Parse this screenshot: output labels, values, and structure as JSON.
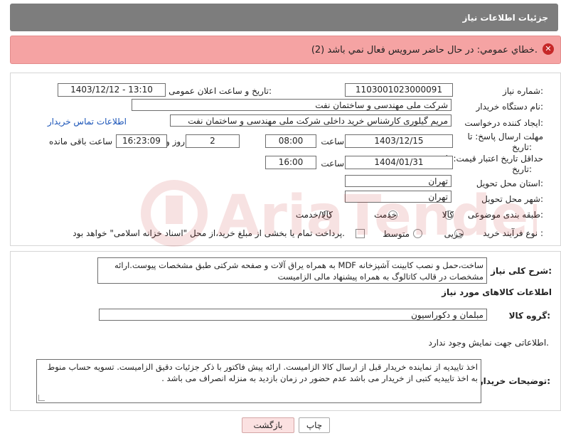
{
  "header": {
    "title": "جزئیات اطلاعات نیاز"
  },
  "error": {
    "message": "خطاي عمومي: در حال حاضر سرويس فعال نمي باشد (2)."
  },
  "form": {
    "need_number_label": "شماره نیاز:",
    "need_number": "1103001023000091",
    "announce_label": "تاریخ و ساعت اعلان عمومی:",
    "announce_value": "1403/12/12 - 13:10",
    "buyer_label": "نام دستگاه خریدار:",
    "buyer_value": "شرکت ملی مهندسی و ساختمان نفت",
    "creator_label": "ایجاد کننده درخواست:",
    "creator_value": "مریم گیلوری کارشناس خرید داخلی شرکت ملی مهندسی و ساختمان نفت",
    "contact_link": "اطلاعات تماس خریدار",
    "deadline_label_1": "مهلت ارسال پاسخ: تا",
    "deadline_label_2": "تاریخ:",
    "deadline_date": "1403/12/15",
    "time_label": "ساعت",
    "deadline_time": "08:00",
    "days_value": "2",
    "days_label": "روز و",
    "remaining_time": "16:23:09",
    "remaining_label": "ساعت باقی مانده",
    "validity_label_1": "حداقل تاریخ اعتبار قیمت: تا",
    "validity_label_2": "تاریخ:",
    "validity_date": "1404/01/31",
    "validity_time": "16:00",
    "province_label": "استان محل تحویل:",
    "province_value": "تهران",
    "city_label": "شهر محل تحویل:",
    "city_value": "تهران",
    "category_label": "طبقه بندی موضوعی:",
    "category_options": [
      "کالا",
      "خدمت",
      "کالا/خدمت"
    ],
    "process_label": "نوع فرآیند خرید :",
    "process_options": [
      "جزیی",
      "متوسط"
    ],
    "payment_note": "پرداخت تمام یا بخشی از مبلغ خرید،از محل \"اسناد خزانه اسلامی\" خواهد بود."
  },
  "details": {
    "summary_label": "شرح کلی نیاز:",
    "summary_text": "ساخت،حمل و نصب کابینت آشپزخانه MDF به همراه یراق آلات و صفحه شرکتی طبق مشخصات پیوست.ارائه مشخصات در قالب کاتالوگ به همراه پیشنهاد مالی الزامیست",
    "goods_heading": "اطلاعات کالاهای مورد نیاز",
    "group_label": "گروه کالا:",
    "group_value": "مبلمان و دکوراسیون",
    "no_info": "اطلاعاتی جهت نمایش وجود ندارد.",
    "buyer_notes_label": "توضیحات خریدار:",
    "buyer_notes_text": "اخذ تاییدیه از نماینده خریدار قبل از ارسال کالا الزامیست. ارائه پیش فاکتور با ذکر جزئیات دقیق الزامیست. تسویه حساب منوط به اخذ تاییدیه کتبی از خریدار می باشد عدم حضور در زمان بازدید به منزله انصراف می باشد ."
  },
  "buttons": {
    "print": "چاپ",
    "back": "بازگشت"
  },
  "watermark": {
    "text": "AriaTender.neT"
  }
}
